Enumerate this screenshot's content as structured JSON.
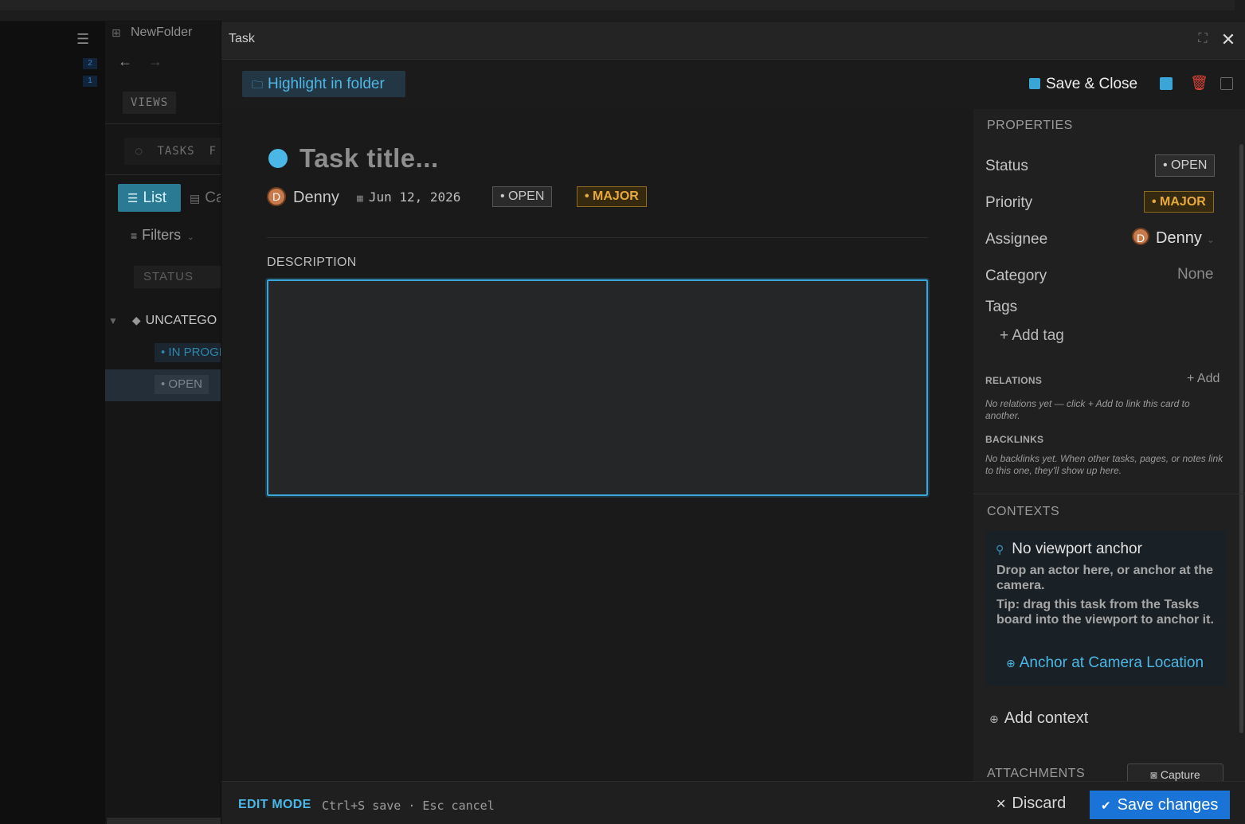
{
  "background_app": {
    "badges": [
      "2",
      "1"
    ],
    "folder_tab": "NewFolder",
    "nav_back": "←",
    "nav_forward": "→",
    "views_label": "VIEWS",
    "tasks_label": "TASKS",
    "tasks_truncated": "F",
    "list_button": "List",
    "calendar_button_truncated": "Ca",
    "filters_label": "Filters",
    "status_header": "STATUS",
    "group_label": "UNCATEGO",
    "in_progress_pill": "• IN PROGI",
    "open_pill": "• OPEN"
  },
  "modal": {
    "title": "Task",
    "toolbar": {
      "highlight_label": "Highlight in folder",
      "save_close_label": "Save & Close"
    },
    "task": {
      "title_placeholder": "Task title...",
      "assignee": "Denny",
      "assignee_initial": "D",
      "due_date": "Jun 12, 2026",
      "status": "• OPEN",
      "priority": "• MAJOR",
      "description_label": "DESCRIPTION",
      "description_value": ""
    },
    "properties": {
      "section_title": "PROPERTIES",
      "status_label": "Status",
      "status_value": "• OPEN",
      "priority_label": "Priority",
      "priority_value": "• MAJOR",
      "assignee_label": "Assignee",
      "assignee_value": "Denny",
      "assignee_initial": "D",
      "category_label": "Category",
      "category_value": "None",
      "tags_label": "Tags",
      "add_tag_label": "+ Add tag",
      "relations_label": "RELATIONS",
      "relations_add": "+ Add",
      "relations_hint": "No relations yet — click + Add to link this card to another.",
      "backlinks_label": "BACKLINKS",
      "backlinks_hint": "No backlinks yet. When other tasks, pages, or notes link to this one, they'll show up here."
    },
    "contexts": {
      "section_title": "CONTEXTS",
      "card_title": "No viewport anchor",
      "drop_text": "Drop an actor here, or anchor at the camera.",
      "tip_text": "Tip: drag this task from the Tasks board into the viewport to anchor it.",
      "anchor_button": "Anchor at Camera Location",
      "add_context_label": "Add context"
    },
    "attachments": {
      "section_title": "ATTACHMENTS",
      "capture_button": "Capture"
    },
    "footer": {
      "mode_label": "EDIT MODE",
      "shortcut_hint": "Ctrl+S save · Esc cancel",
      "discard_label": "Discard",
      "save_changes_label": "Save changes"
    }
  },
  "colors": {
    "accent": "#4ab7e6",
    "primary_button": "#1a73d6",
    "danger": "#e0443a",
    "major": "#e8a93a"
  }
}
